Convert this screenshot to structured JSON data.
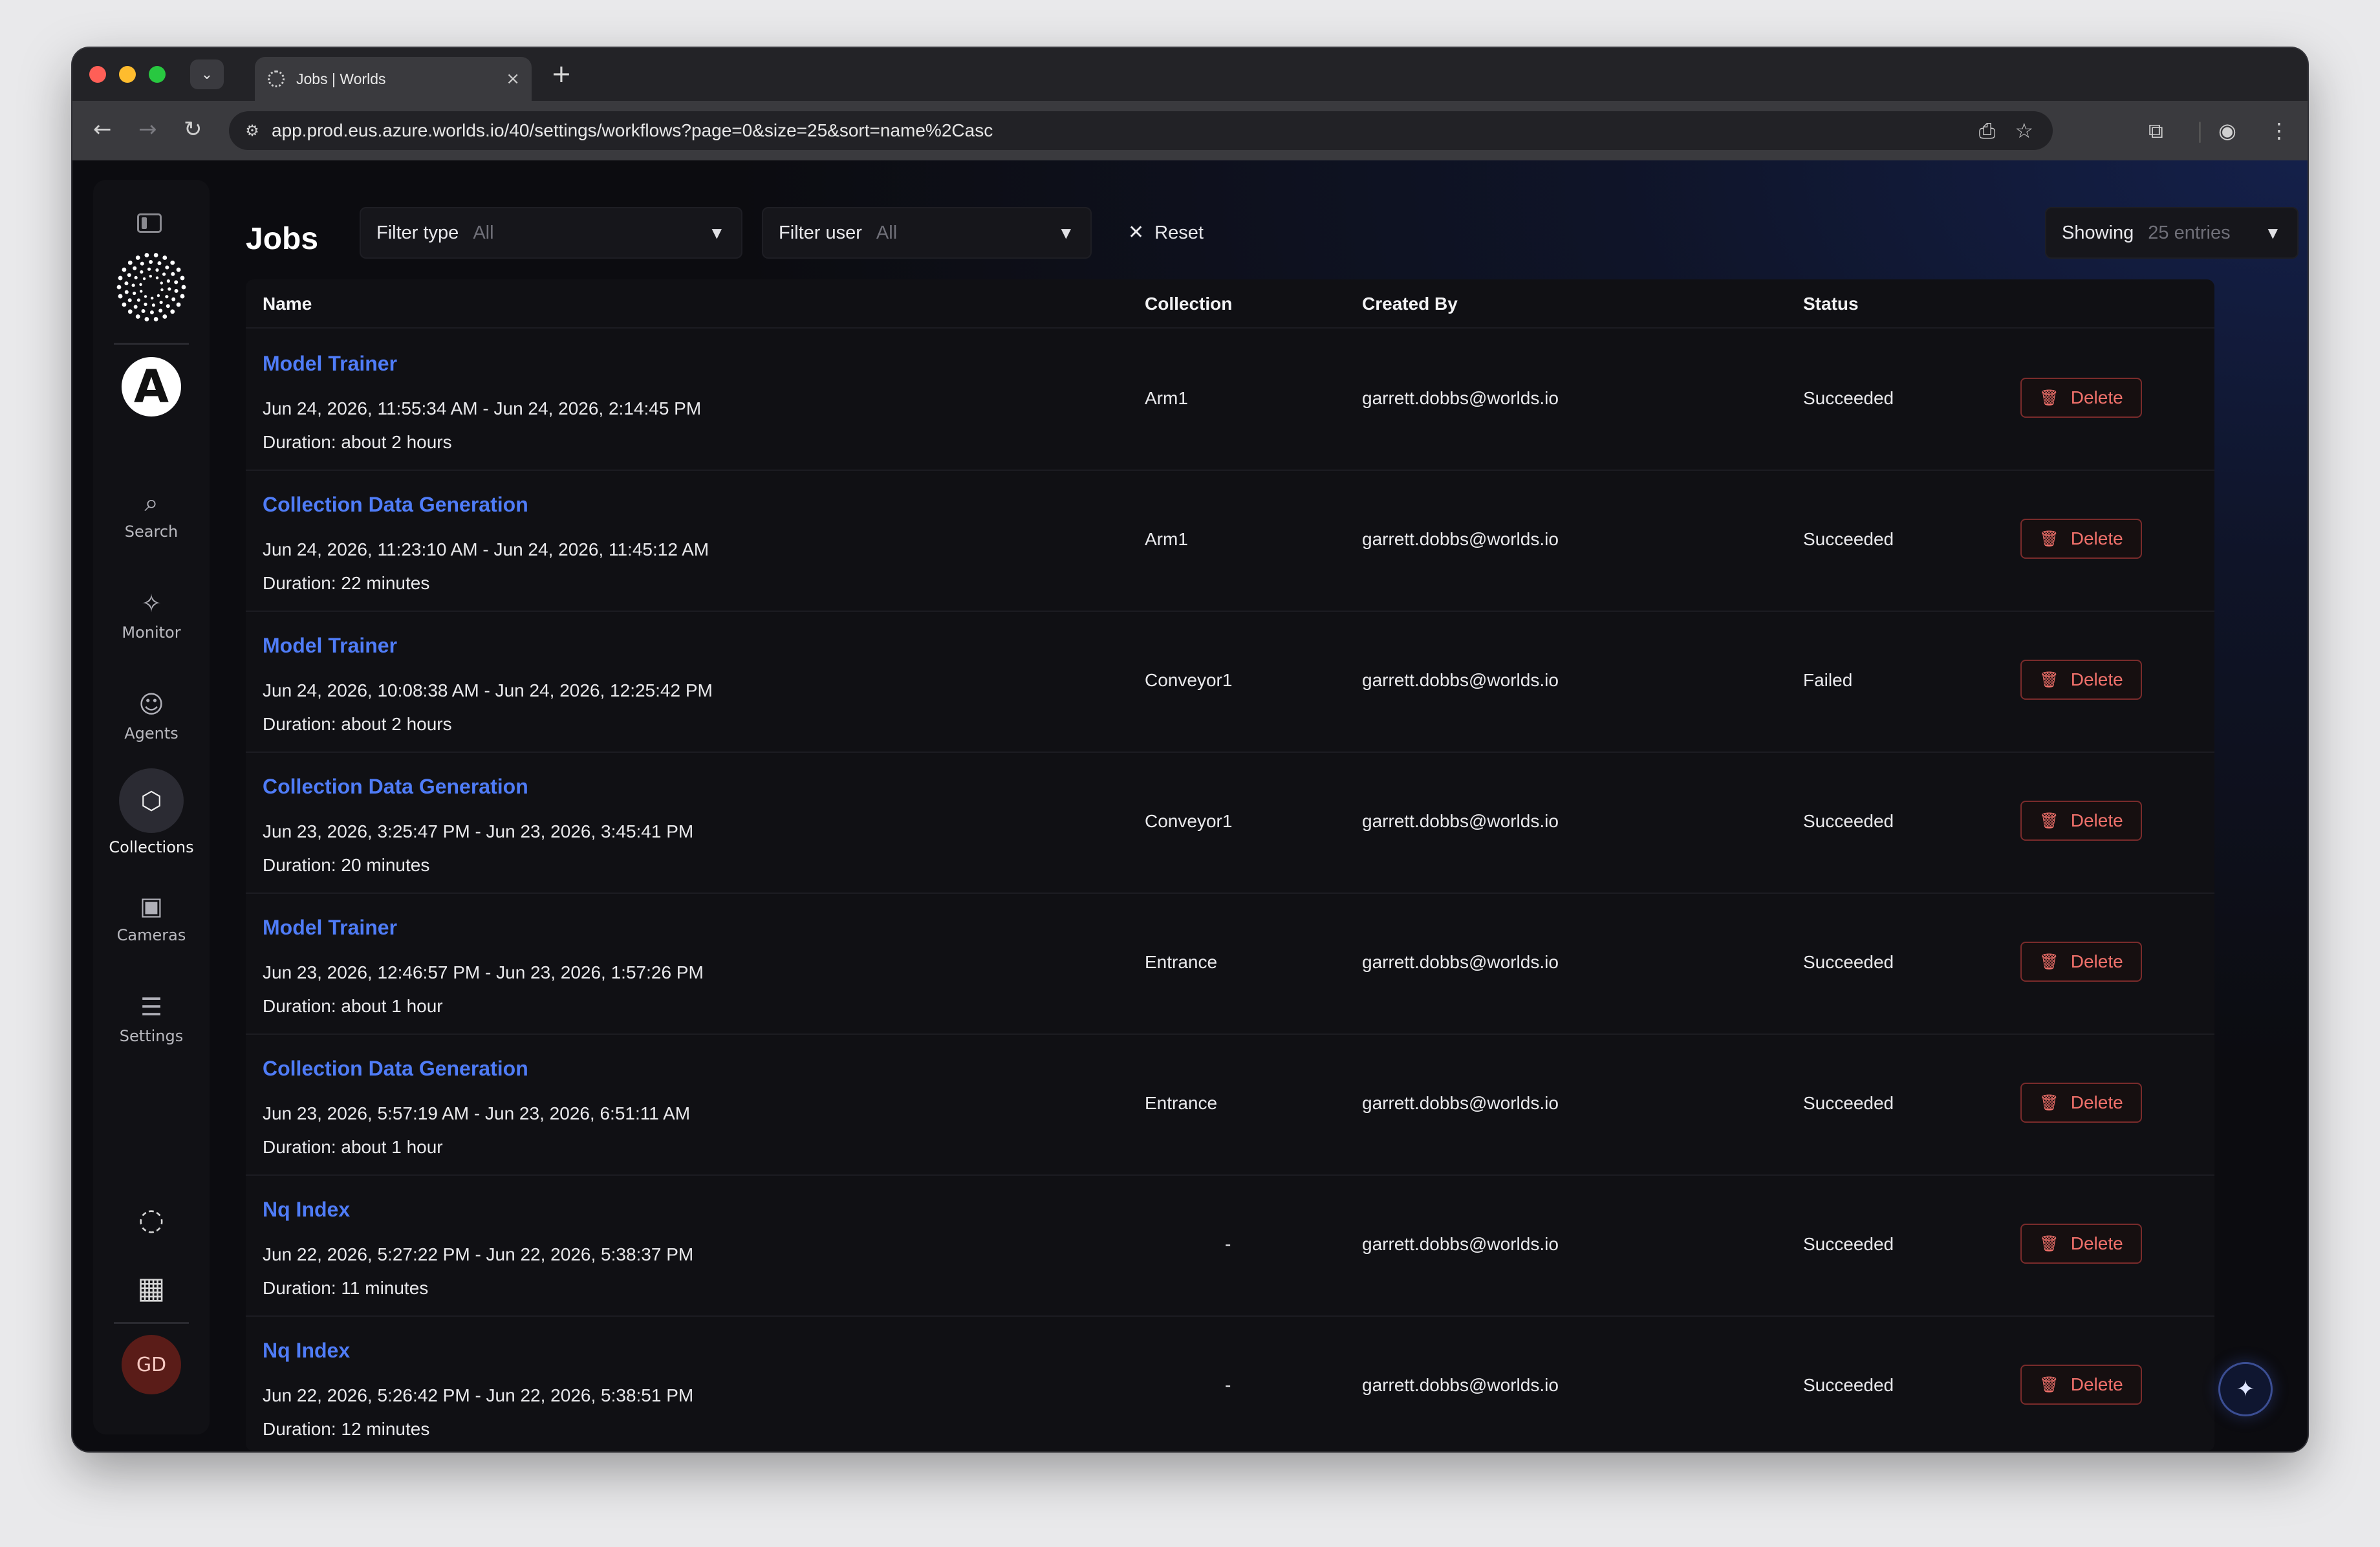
{
  "browser": {
    "tab_title": "Jobs | Worlds",
    "url": "app.prod.eus.azure.worlds.io/40/settings/workflows?page=0&size=25&sort=name%2Casc"
  },
  "sidebar": {
    "org_letter": "A",
    "items": [
      {
        "label": "Search",
        "icon": "search-icon",
        "glyph": "⌕"
      },
      {
        "label": "Monitor",
        "icon": "monitor-icon",
        "glyph": "✧"
      },
      {
        "label": "Agents",
        "icon": "robot-icon",
        "glyph": "☺"
      },
      {
        "label": "Collections",
        "icon": "collections-icon",
        "glyph": "⬡",
        "active": true
      },
      {
        "label": "Cameras",
        "icon": "camera-icon",
        "glyph": "▣"
      },
      {
        "label": "Settings",
        "icon": "sliders-icon",
        "glyph": "☰"
      }
    ],
    "avatar_initials": "GD"
  },
  "header": {
    "title": "Jobs",
    "filter_type_label": "Filter type",
    "filter_type_value": "All",
    "filter_user_label": "Filter user",
    "filter_user_value": "All",
    "reset_label": "Reset",
    "showing_label": "Showing",
    "showing_value": "25 entries"
  },
  "table": {
    "columns": {
      "name": "Name",
      "collection": "Collection",
      "created_by": "Created By",
      "status": "Status"
    },
    "delete_label": "Delete",
    "rows": [
      {
        "name": "Model Trainer",
        "range": "Jun 24, 2026, 11:55:34 AM - Jun 24, 2026, 2:14:45 PM",
        "duration": "Duration: about 2 hours",
        "collection": "Arm1",
        "created_by": "garrett.dobbs@worlds.io",
        "status": "Succeeded"
      },
      {
        "name": "Collection Data Generation",
        "range": "Jun 24, 2026, 11:23:10 AM - Jun 24, 2026, 11:45:12 AM",
        "duration": "Duration: 22 minutes",
        "collection": "Arm1",
        "created_by": "garrett.dobbs@worlds.io",
        "status": "Succeeded"
      },
      {
        "name": "Model Trainer",
        "range": "Jun 24, 2026, 10:08:38 AM - Jun 24, 2026, 12:25:42 PM",
        "duration": "Duration: about 2 hours",
        "collection": "Conveyor1",
        "created_by": "garrett.dobbs@worlds.io",
        "status": "Failed"
      },
      {
        "name": "Collection Data Generation",
        "range": "Jun 23, 2026, 3:25:47 PM - Jun 23, 2026, 3:45:41 PM",
        "duration": "Duration: 20 minutes",
        "collection": "Conveyor1",
        "created_by": "garrett.dobbs@worlds.io",
        "status": "Succeeded"
      },
      {
        "name": "Model Trainer",
        "range": "Jun 23, 2026, 12:46:57 PM - Jun 23, 2026, 1:57:26 PM",
        "duration": "Duration: about 1 hour",
        "collection": "Entrance",
        "created_by": "garrett.dobbs@worlds.io",
        "status": "Succeeded"
      },
      {
        "name": "Collection Data Generation",
        "range": "Jun 23, 2026, 5:57:19 AM - Jun 23, 2026, 6:51:11 AM",
        "duration": "Duration: about 1 hour",
        "collection": "Entrance",
        "created_by": "garrett.dobbs@worlds.io",
        "status": "Succeeded"
      },
      {
        "name": "Nq Index",
        "range": "Jun 22, 2026, 5:27:22 PM - Jun 22, 2026, 5:38:37 PM",
        "duration": "Duration: 11 minutes",
        "collection": "-",
        "created_by": "garrett.dobbs@worlds.io",
        "status": "Succeeded"
      },
      {
        "name": "Nq Index",
        "range": "Jun 22, 2026, 5:26:42 PM - Jun 22, 2026, 5:38:51 PM",
        "duration": "Duration: 12 minutes",
        "collection": "-",
        "created_by": "garrett.dobbs@worlds.io",
        "status": "Succeeded"
      }
    ]
  },
  "colors": {
    "accent": "#4f7cf7",
    "danger": "#f1716b"
  }
}
